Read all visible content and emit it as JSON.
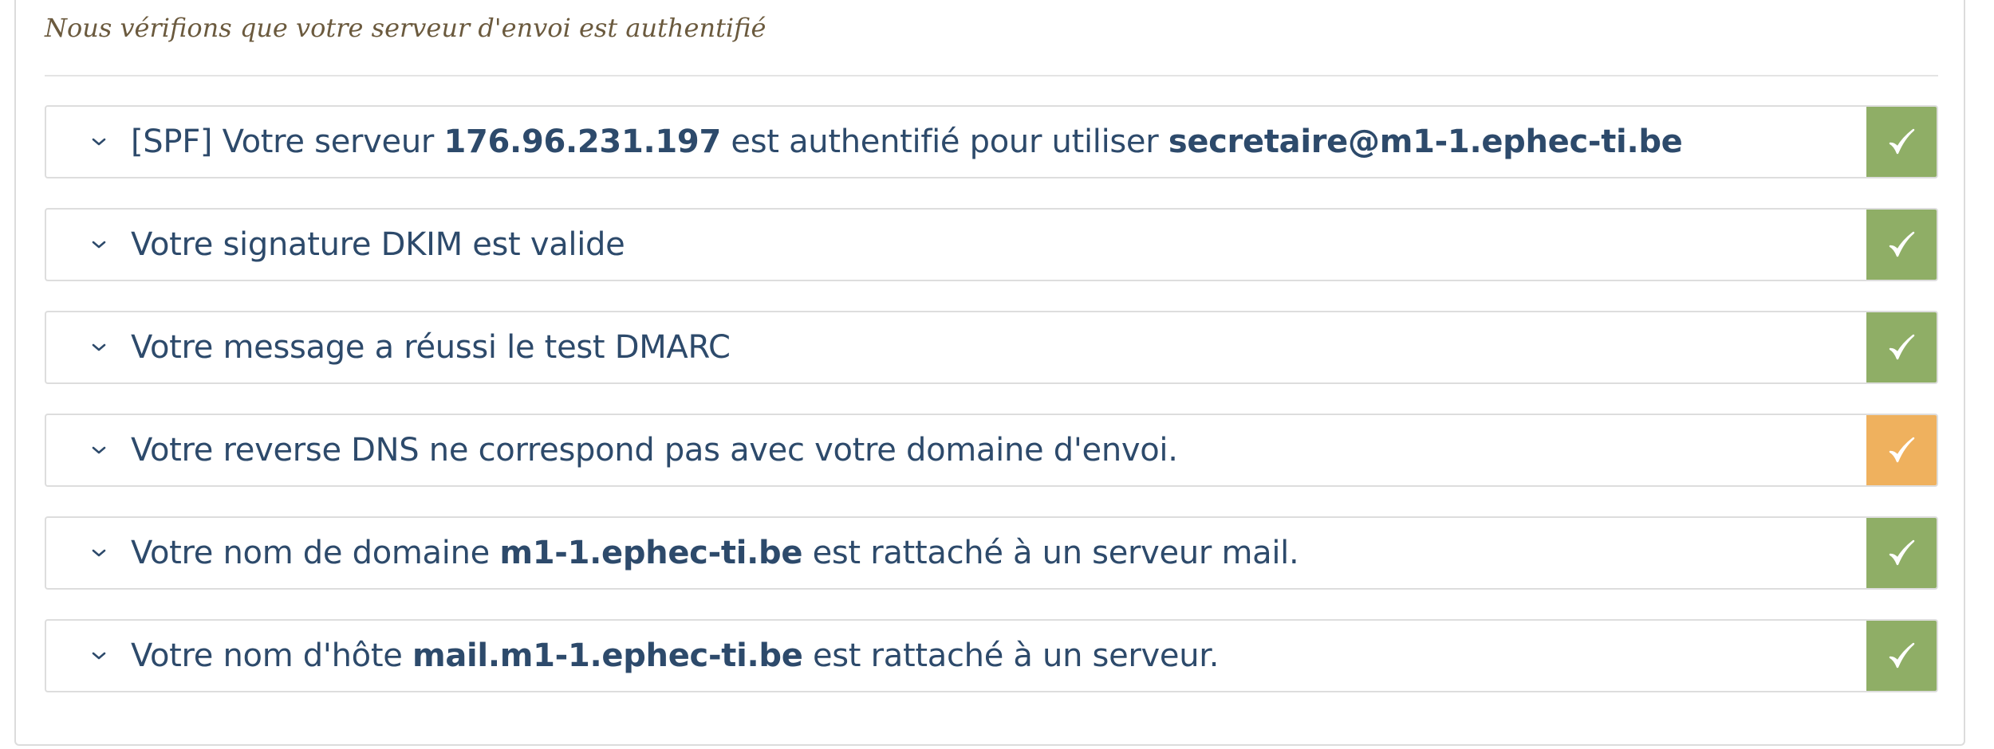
{
  "header": {
    "subtitle": "Nous vérifions que votre serveur d'envoi est authentifié"
  },
  "colors": {
    "ok": "#8fae66",
    "warning": "#efb15e",
    "text": "#2d4a6b"
  },
  "checks": [
    {
      "parts": [
        {
          "text": "[SPF] Votre serveur ",
          "bold": false
        },
        {
          "text": "176.96.231.197",
          "bold": true
        },
        {
          "text": " est authentifié pour utiliser ",
          "bold": false
        },
        {
          "text": "secretaire@m1-1.ephec-ti.be",
          "bold": true
        }
      ],
      "status": "ok",
      "icon": "checkmark-icon"
    },
    {
      "parts": [
        {
          "text": "Votre signature DKIM est valide",
          "bold": false
        }
      ],
      "status": "ok",
      "icon": "checkmark-icon"
    },
    {
      "parts": [
        {
          "text": "Votre message a réussi le test DMARC",
          "bold": false
        }
      ],
      "status": "ok",
      "icon": "checkmark-icon"
    },
    {
      "parts": [
        {
          "text": "Votre reverse DNS ne correspond pas avec votre domaine d'envoi.",
          "bold": false
        }
      ],
      "status": "warning",
      "icon": "checkmark-icon"
    },
    {
      "parts": [
        {
          "text": "Votre nom de domaine ",
          "bold": false
        },
        {
          "text": "m1-1.ephec-ti.be",
          "bold": true
        },
        {
          "text": " est rattaché à un serveur mail.",
          "bold": false
        }
      ],
      "status": "ok",
      "icon": "checkmark-icon"
    },
    {
      "parts": [
        {
          "text": "Votre nom d'hôte ",
          "bold": false
        },
        {
          "text": "mail.m1-1.ephec-ti.be",
          "bold": true
        },
        {
          "text": " est rattaché à un serveur.",
          "bold": false
        }
      ],
      "status": "ok",
      "icon": "checkmark-icon"
    }
  ]
}
